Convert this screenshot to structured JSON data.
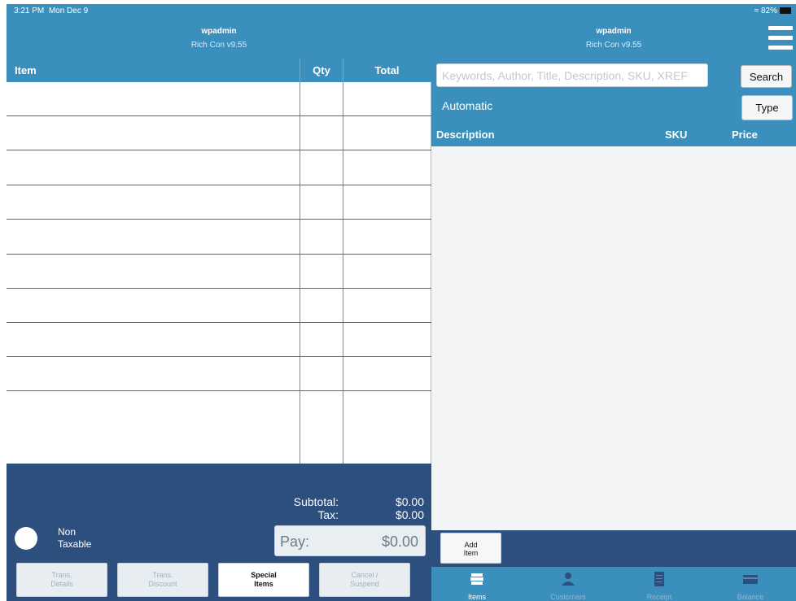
{
  "status": {
    "time": "3:21 PM",
    "date": "Mon Dec 9",
    "battery": "82%"
  },
  "header": {
    "title": "wpadmin",
    "subtitle": "Rich Con v9.55"
  },
  "cart": {
    "columns": {
      "item": "Item",
      "qty": "Qty",
      "total": "Total"
    },
    "row_count": 9
  },
  "totals": {
    "subtotal_label": "Subtotal:",
    "subtotal_value": "$0.00",
    "tax_label": "Tax:",
    "tax_value": "$0.00"
  },
  "non_taxable": {
    "label": "Non\nTaxable",
    "on": false
  },
  "pay": {
    "label": "Pay:",
    "value": "$0.00"
  },
  "actions": [
    {
      "label": "Trans.\nDetails",
      "enabled": false
    },
    {
      "label": "Trans.\nDiscount",
      "enabled": false
    },
    {
      "label": "Special\nItems",
      "enabled": true
    },
    {
      "label": "Cancel /\nSuspend",
      "enabled": false
    }
  ],
  "search": {
    "placeholder": "Keywords, Author, Title, Description, SKU, XREF",
    "button": "Search"
  },
  "mode": {
    "label": "Automatic",
    "type_button": "Type"
  },
  "results": {
    "columns": {
      "description": "Description",
      "sku": "SKU",
      "price": "Price"
    }
  },
  "add_item": {
    "label": "Add\nItem"
  },
  "tabs": [
    {
      "label": "Items",
      "icon": "items-icon",
      "active": true
    },
    {
      "label": "Customers",
      "icon": "customers-icon",
      "active": false
    },
    {
      "label": "Receipt",
      "icon": "receipt-icon",
      "active": false
    },
    {
      "label": "Balance",
      "icon": "balance-icon",
      "active": false
    }
  ],
  "colors": {
    "header": "#3a8fbd",
    "footer": "#2d4f7d",
    "list_bg": "#f3f4f6"
  }
}
